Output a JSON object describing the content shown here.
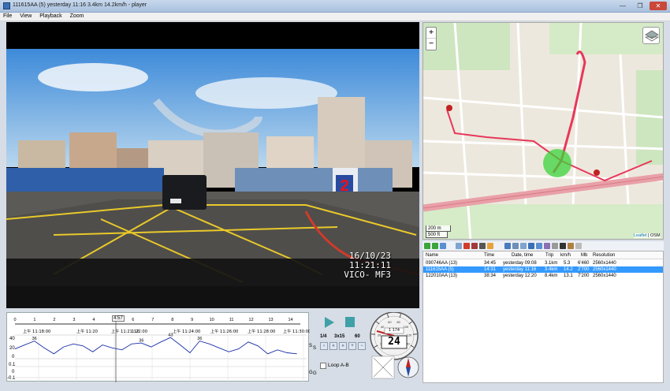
{
  "window": {
    "title": "111615AA (5)   yesterday 11:16   3.4km   14.2km/h - player",
    "controls": [
      "—",
      "❐",
      "✕"
    ]
  },
  "menu": [
    "File",
    "View",
    "Playback",
    "Zoom"
  ],
  "video": {
    "date": "16/10/23",
    "time": "11:21:11",
    "brand": "VICO- MF3",
    "plate": "2",
    "overlay_text": "2"
  },
  "map": {
    "zoom_in": "+",
    "zoom_out": "−",
    "scale_m": "200 m",
    "scale_ft": "500 ft",
    "attribution_link": "Leaflet",
    "attribution_sep": " | ",
    "attribution_osm": "OSM"
  },
  "list": {
    "columns": [
      "Name",
      "Time",
      "Date, time",
      "Trip",
      "km/h",
      "Mb",
      "Resolution"
    ],
    "rows": [
      [
        "090746AA (13)",
        "34:45",
        "yesterday 09:08",
        "3.1km",
        "5.3",
        "6'460",
        "2560x1440"
      ],
      [
        "111615AA (5)",
        "14:31",
        "yesterday 11:16",
        "3.4km",
        "14.2",
        "2'700",
        "2560x1440"
      ],
      [
        "122010AA (13)",
        "38:34",
        "yesterday 12:20",
        "8.4km",
        "13.1",
        "7'200",
        "2560x1440"
      ]
    ],
    "selected_index": 1
  },
  "timeline": {
    "ticks": [
      "0",
      "1",
      "2",
      "3",
      "4",
      "5",
      "6",
      "7",
      "8",
      "9",
      "10",
      "11",
      "12",
      "13",
      "14"
    ],
    "cursor_label": "4:57",
    "clock_labels": [
      "上午 11:18:00",
      "上午 11:20",
      "上午 11:21:12",
      "1:22:00",
      "上午 11:24:00",
      "上午 11:26:00",
      "上午 11:28:00",
      "上午 11:30:00"
    ],
    "speed_axis": [
      "40",
      "20",
      "0"
    ],
    "g_axis": [
      "0.1",
      "0",
      "-0.1"
    ],
    "speed_peaks": [
      "36",
      "36",
      "43",
      "36"
    ],
    "s_label": "S",
    "g_label": "G"
  },
  "controls": {
    "rate_label": "1/4",
    "fps_label": "3x15",
    "fps2_label": "60",
    "loop_label": "Loop A-B"
  },
  "gauge": {
    "speed": "24",
    "odometer": "1 174",
    "scale": [
      "0",
      "20",
      "40",
      "60",
      "80",
      "100",
      "120",
      "140"
    ]
  },
  "colors": {
    "selection": "#3399ff",
    "route": "#e8375a",
    "speed_line": "#1a2fa8",
    "road_major": "#e9a0a8"
  },
  "chart_data": {
    "type": "line",
    "x": [
      0,
      0.5,
      1,
      1.5,
      2,
      2.5,
      3,
      3.5,
      4,
      4.5,
      5,
      5.5,
      6,
      6.5,
      7,
      7.5,
      8,
      8.5,
      9,
      9.5,
      10,
      10.5,
      11,
      11.5,
      12,
      12.5,
      13,
      13.5,
      14,
      14.5
    ],
    "series": [
      {
        "values": [
          20,
          28,
          36,
          22,
          10,
          24,
          30,
          26,
          14,
          28,
          22,
          18,
          30,
          32,
          24,
          34,
          43,
          28,
          12,
          36,
          30,
          22,
          14,
          20,
          34,
          26,
          10,
          18,
          12,
          10
        ]
      }
    ],
    "ylim": [
      0,
      45
    ],
    "xlim": [
      0,
      15
    ]
  }
}
